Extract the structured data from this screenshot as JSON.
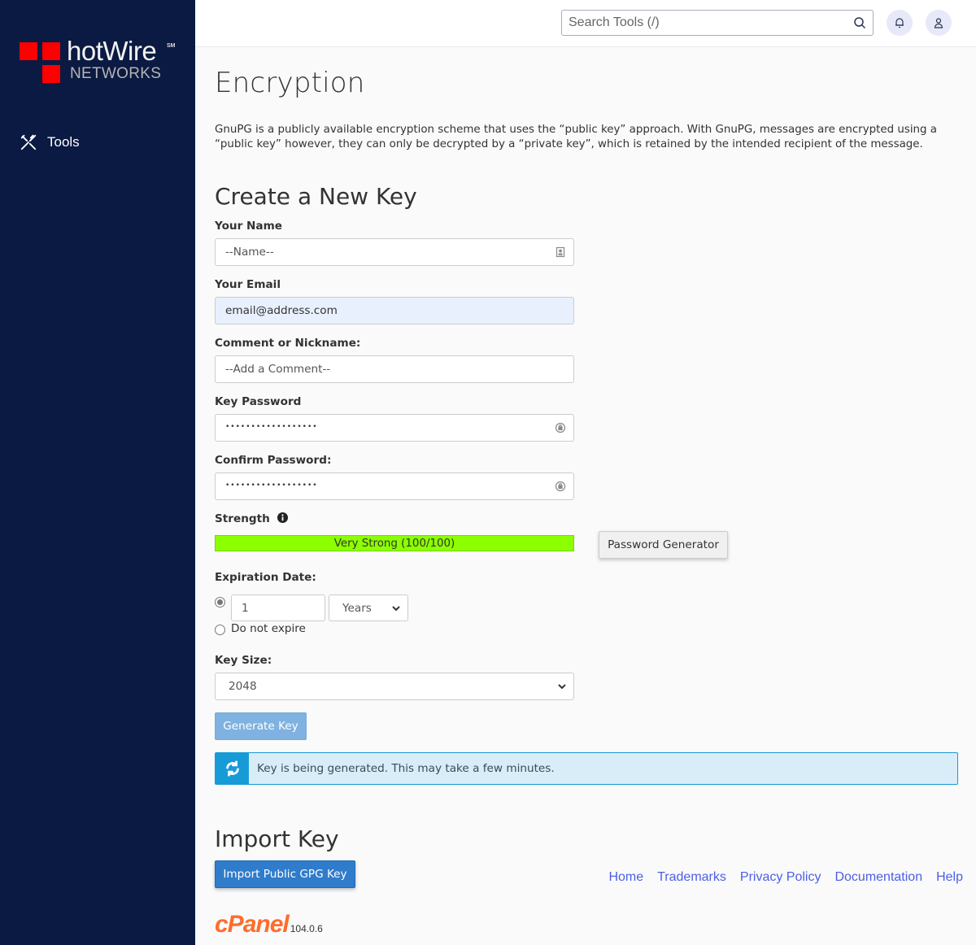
{
  "sidebar": {
    "logo": {
      "brand": "hotWire",
      "service_mark": "SM",
      "subtitle": "NETWORKS"
    },
    "nav": [
      {
        "label": "Tools",
        "icon": "tools-icon"
      }
    ]
  },
  "header": {
    "search": {
      "placeholder": "Search Tools (/)",
      "value": ""
    },
    "icons": [
      "bell-icon",
      "user-icon"
    ]
  },
  "page": {
    "title": "Encryption",
    "intro": "GnuPG is a publicly available encryption scheme that uses the “public key” approach. With GnuPG, messages are encrypted using a “public key” however, they can only be decrypted by a “private key”, which is retained by the intended recipient of the message."
  },
  "create": {
    "heading": "Create a New Key",
    "name": {
      "label": "Your Name",
      "placeholder": "--Name--",
      "value": ""
    },
    "email": {
      "label": "Your Email",
      "value": "email@address.com"
    },
    "comment": {
      "label": "Comment or Nickname:",
      "placeholder": "--Add a Comment--",
      "value": ""
    },
    "password": {
      "label": "Key Password",
      "masked": "••••••••••••••••••"
    },
    "confirm": {
      "label": "Confirm Password:",
      "masked": "••••••••••••••••••"
    },
    "strength": {
      "label": "Strength",
      "text": "Very Strong (100/100)",
      "score": 100,
      "max": 100,
      "color": "#8cff00"
    },
    "password_generator_label": "Password Generator",
    "expiration": {
      "label": "Expiration Date:",
      "selected": "duration",
      "amount": "1",
      "unit": "Years",
      "no_expire_label": "Do not expire"
    },
    "key_size": {
      "label": "Key Size:",
      "value": "2048"
    },
    "generate_label": "Generate Key",
    "alert": {
      "message": "Key is being generated. This may take a few minutes.",
      "color": "#179bd7"
    }
  },
  "import": {
    "heading": "Import Key",
    "button_label": "Import Public GPG Key"
  },
  "footer": {
    "brand": "cPanel",
    "version": "104.0.6",
    "links": [
      "Home",
      "Trademarks",
      "Privacy Policy",
      "Documentation",
      "Help"
    ]
  }
}
